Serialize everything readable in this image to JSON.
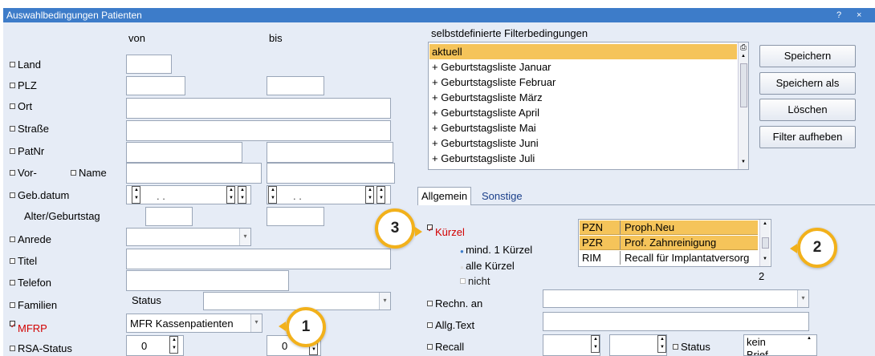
{
  "window": {
    "title": "Auswahlbedingungen Patienten",
    "help": "?",
    "close": "×"
  },
  "cols": {
    "von": "von",
    "bis": "bis"
  },
  "fields": {
    "land": "Land",
    "plz": "PLZ",
    "ort": "Ort",
    "strasse": "Straße",
    "patnr": "PatNr",
    "vor": "Vor-",
    "name": "Name",
    "gebdatum": "Geb.datum",
    "alter": "Alter/Geburtstag",
    "anrede": "Anrede",
    "titel": "Titel",
    "telefon": "Telefon",
    "familien": "Familien",
    "mfrp": "MFRP",
    "rsa": "RSA-Status",
    "status": "Status",
    "mfrp_value": "MFR Kassenpatienten",
    "date_placeholder": ".  .",
    "rsa_von": "0",
    "rsa_bis": "0"
  },
  "filter": {
    "title": "selbstdefinierte Filterbedingungen",
    "items": [
      "aktuell",
      "+ Geburtstagsliste Januar",
      "+ Geburtstagsliste Februar",
      "+ Geburtstagsliste März",
      "+ Geburtstagsliste April",
      "+ Geburtstagsliste Mai",
      "+ Geburtstagsliste Juni",
      "+ Geburtstagsliste Juli"
    ]
  },
  "buttons": {
    "save": "Speichern",
    "save_as": "Speichern als",
    "delete": "Löschen",
    "clear": "Filter aufheben"
  },
  "tabs": {
    "general": "Allgemein",
    "other": "Sonstige"
  },
  "kuerzel": {
    "label": "Kürzel",
    "min1": "mind. 1 Kürzel",
    "all": "alle Kürzel",
    "not": "nicht",
    "rows": [
      {
        "code": "PZN",
        "desc": "Proph.Neu"
      },
      {
        "code": "PZR",
        "desc": "Prof. Zahnreinigung"
      },
      {
        "code": "RIM",
        "desc": "Recall für Implantatversorg"
      }
    ],
    "count": "2"
  },
  "right": {
    "rechn": "Rechn. an",
    "allg": "Allg.Text",
    "recall": "Recall",
    "status": "Status",
    "kein": "kein",
    "brief": "Brief"
  },
  "callouts": {
    "c1": "1",
    "c2": "2",
    "c3": "3"
  },
  "colors": {
    "titlebar": "#3d7cc9",
    "selected": "#f5c45a",
    "callout": "#f2b11b",
    "red": "#d20000"
  }
}
